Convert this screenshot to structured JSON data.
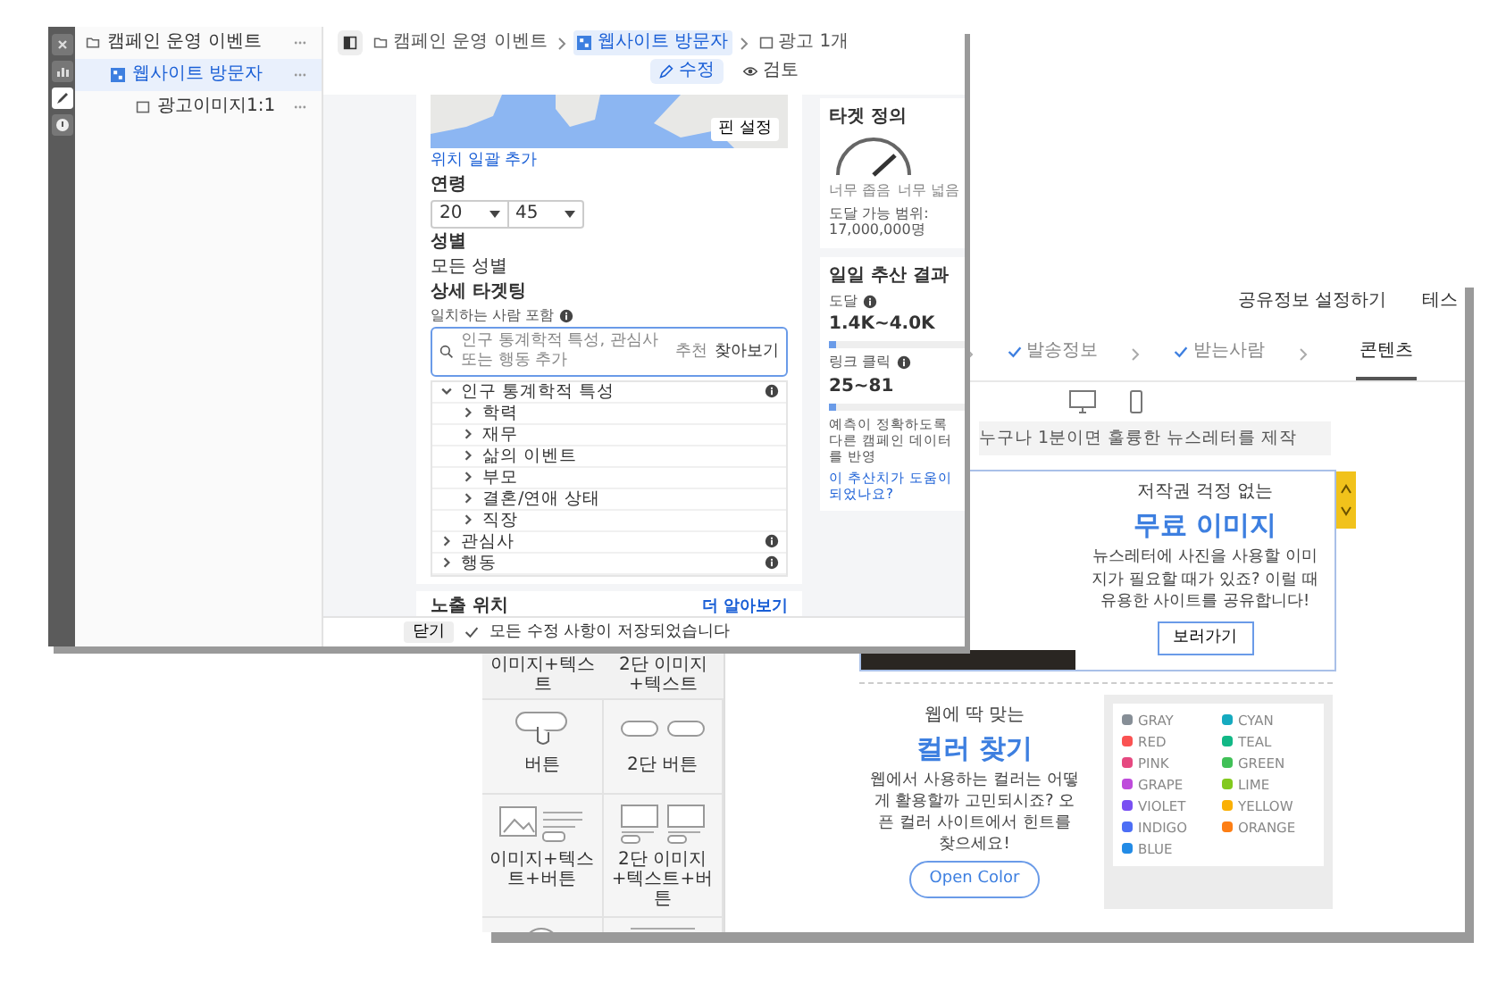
{
  "editor_window": {
    "rail_icons": [
      {
        "kind": "close",
        "selected": false
      },
      {
        "kind": "chart",
        "selected": false
      },
      {
        "kind": "edit",
        "selected": true
      },
      {
        "kind": "info",
        "selected": false
      }
    ],
    "tree": [
      {
        "label": "캠페인 운영 이벤트",
        "kind": "campaign",
        "selected": false,
        "children": [
          {
            "label": "웹사이트 방문자",
            "kind": "adset",
            "selected": true,
            "children": [
              {
                "label": "광고이미지1:1",
                "kind": "ad",
                "selected": false
              }
            ]
          }
        ]
      }
    ],
    "breadcrumb": [
      {
        "label": "캠페인 운영 이벤트",
        "kind": "campaign"
      },
      {
        "label": "웹사이트 방문자",
        "kind": "adset"
      },
      {
        "label": "광고 1개",
        "kind": "ad"
      }
    ],
    "mode_tabs": [
      {
        "label": "수정",
        "kind": "edit",
        "selected": true
      },
      {
        "label": "검토",
        "kind": "review",
        "selected": false
      }
    ],
    "map": {
      "pin_button": "핀 설정"
    },
    "bulk_location_link": "위치 일괄 추가",
    "age": {
      "label": "연령",
      "min": "20",
      "max": "45"
    },
    "gender": {
      "label": "성별",
      "value": "모든 성별"
    },
    "detailed_targeting": {
      "label": "상세 타겟팅",
      "sublabel": "일치하는 사람 포함",
      "search": {
        "placeholder": "인구 통계학적 특성, 관심사 또는 행동 추가",
        "suggest": "추천",
        "browse": "찾아보기"
      },
      "categories": [
        {
          "label": "인구 통계학적 특성",
          "expanded": true,
          "children": [
            {
              "label": "학력",
              "expanded": false
            },
            {
              "label": "재무",
              "expanded": false
            },
            {
              "label": "삶의 이벤트",
              "expanded": false
            },
            {
              "label": "부모",
              "expanded": false
            },
            {
              "label": "결혼/연애 상태",
              "expanded": false
            },
            {
              "label": "직장",
              "expanded": false
            }
          ]
        },
        {
          "label": "관심사",
          "expanded": false
        },
        {
          "label": "행동",
          "expanded": false
        }
      ]
    },
    "placement": {
      "title": "노출 위치",
      "link": "더 알아보기"
    },
    "footer": {
      "close_button": "닫기",
      "status": "모든 수정 사항이 저장되었습니다"
    },
    "audience_card": {
      "title": "타겟 정의",
      "narrow_label": "너무 좁음",
      "broad_label": "너무 넓음",
      "reach": "도달 가능 범위: 17,000,000명"
    },
    "estimate_card": {
      "title": "일일 추산 결과",
      "metrics": [
        {
          "label": "도달",
          "value": "1.4K~4.0K",
          "level": 0.05
        },
        {
          "label": "링크 클릭",
          "value": "25~81",
          "level": 0.05
        }
      ],
      "note": "예측이 정확하도록 다른 캠페인 데이터를 반영",
      "link": "이 추산치가 도움이 되었나요?"
    }
  },
  "newsletter_window": {
    "top_links": [
      "공유정보 설정하기",
      "테스"
    ],
    "steps": [
      {
        "label": "발송정보",
        "done": true,
        "selected": false
      },
      {
        "label": "받는사람",
        "done": true,
        "selected": false
      },
      {
        "label": "콘텐츠",
        "done": false,
        "selected": true
      }
    ],
    "device_icons": [
      {
        "kind": "desktop"
      },
      {
        "kind": "mobile"
      }
    ],
    "intro_text": "누구나 1분이면 훌륭한 뉴스레터를 제작",
    "palette": {
      "top_labels": [
        "이미지+텍스트",
        "2단 이미지+텍스트"
      ],
      "tiles": [
        {
          "kind": "button",
          "label": "버튼"
        },
        {
          "kind": "two_buttons",
          "label": "2단 버튼"
        },
        {
          "kind": "image_text_button",
          "label": "이미지+텍스트+버튼"
        },
        {
          "kind": "two_image_text_button",
          "label": "2단 이미지+텍스트+버튼"
        },
        {
          "kind": "badge"
        },
        {
          "kind": "text_box"
        }
      ]
    },
    "blocks": [
      {
        "kind": "image",
        "kicker": "저작권 걱정 없는",
        "heading": "무료 이미지",
        "body": "뉴스레터에 사진을 사용할 이미지가 필요할 때가 있죠? 이럴 때 유용한 사이트를 공유합니다!",
        "button": "보러가기"
      },
      {
        "kind": "colors",
        "kicker": "웹에 딱 맞는",
        "heading": "컬러 찾기",
        "body": "웹에서 사용하는 컬러는 어떻게 활용할까 고민되시죠? 오픈 컬러 사이트에서 힌트를 찾으세요!",
        "button": "Open Color",
        "colors": [
          {
            "name": "GRAY",
            "color": "#868e96"
          },
          {
            "name": "CYAN",
            "color": "#15aabf"
          },
          {
            "name": "RED",
            "color": "#fa5252"
          },
          {
            "name": "TEAL",
            "color": "#12b886"
          },
          {
            "name": "PINK",
            "color": "#e64980"
          },
          {
            "name": "GREEN",
            "color": "#40c057"
          },
          {
            "name": "GRAPE",
            "color": "#be4bdb"
          },
          {
            "name": "LIME",
            "color": "#82c91e"
          },
          {
            "name": "VIOLET",
            "color": "#7950f2"
          },
          {
            "name": "YELLOW",
            "color": "#fab005"
          },
          {
            "name": "INDIGO",
            "color": "#4c6ef5"
          },
          {
            "name": "ORANGE",
            "color": "#fd7e14"
          },
          {
            "name": "BLUE",
            "color": "#228be6"
          }
        ]
      }
    ]
  }
}
